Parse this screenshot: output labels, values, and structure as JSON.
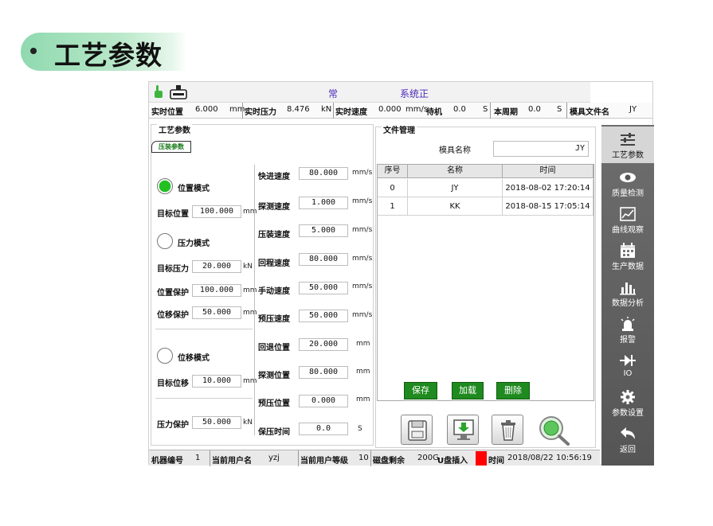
{
  "slide": {
    "title": "工艺参数"
  },
  "topbar": {
    "status_left": "常",
    "status_right": "系统正"
  },
  "infobar": {
    "pos_label": "实时位置",
    "pos_value": "6.000",
    "pos_unit": "mm",
    "force_label": "实时压力",
    "force_value": "8.476",
    "force_unit": "kN",
    "speed_label": "实时速度",
    "speed_value": "0.000",
    "speed_unit": "mm/s",
    "standby_label": "待机",
    "standby_value": "0.0",
    "standby_unit": "S",
    "cycle_label": "本周期",
    "cycle_value": "0.0",
    "cycle_unit": "S",
    "mold_label": "模具文件名",
    "mold_value": "JY"
  },
  "params": {
    "title": "工艺参数",
    "tab": "压装参数",
    "position_mode": "位置模式",
    "target_position_label": "目标位置",
    "target_position": "100.000",
    "mm": "mm",
    "pressure_mode": "压力模式",
    "target_pressure_label": "目标压力",
    "target_pressure": "20.000",
    "kN": "kN",
    "position_protect_label": "位置保护",
    "position_protect": "100.000",
    "displacement_protect_label": "位移保护",
    "displacement_protect": "50.000",
    "displacement_mode": "位移模式",
    "target_displacement_label": "目标位移",
    "target_displacement": "10.000",
    "pressure_protect_label": "压力保护",
    "pressure_protect": "50.000",
    "fast_speed_label": "快进速度",
    "fast_speed": "80.000",
    "mms": "mm/s",
    "probe_speed_label": "探测速度",
    "probe_speed": "1.000",
    "press_speed_label": "压装速度",
    "press_speed": "5.000",
    "return_speed_label": "回程速度",
    "return_speed": "80.000",
    "manual_speed_label": "手动速度",
    "manual_speed": "50.000",
    "prepress_speed_label": "预压速度",
    "prepress_speed": "50.000",
    "retreat_pos_label": "回退位置",
    "retreat_pos": "20.000",
    "probe_pos_label": "探测位置",
    "probe_pos": "80.000",
    "prepress_pos_label": "预压位置",
    "prepress_pos": "0.000",
    "hold_time_label": "保压时间",
    "hold_time": "0.0",
    "s": "S"
  },
  "files": {
    "title": "文件管理",
    "mold_name_label": "模具名称",
    "mold_name_value": "JY",
    "columns": [
      "序号",
      "名称",
      "时间"
    ],
    "rows": [
      {
        "idx": "0",
        "name": "JY",
        "time": "2018-08-02 17:20:14"
      },
      {
        "idx": "1",
        "name": "KK",
        "time": "2018-08-15 17:05:14"
      }
    ],
    "save": "保存",
    "load": "加载",
    "delete": "删除"
  },
  "sidebar": [
    {
      "label": "工艺参数",
      "icon": "sliders-icon"
    },
    {
      "label": "质量检测",
      "icon": "eye-icon"
    },
    {
      "label": "曲线观察",
      "icon": "curve-icon"
    },
    {
      "label": "生产数据",
      "icon": "calendar-icon"
    },
    {
      "label": "数据分析",
      "icon": "bar-chart-icon"
    },
    {
      "label": "报警",
      "icon": "alarm-icon"
    },
    {
      "label": "IO",
      "icon": "diode-icon"
    },
    {
      "label": "参数设置",
      "icon": "gear-icon"
    },
    {
      "label": "返回",
      "icon": "back-icon"
    }
  ],
  "bottombar": {
    "machine_label": "机器编号",
    "machine_value": "1",
    "user_label": "当前用户名",
    "user_value": "yzj",
    "level_label": "当前用户等级",
    "level_value": "10",
    "disk_label": "磁盘剩余",
    "disk_value": "200G",
    "usb_label": "U盘插入",
    "time_label": "时间",
    "date_value": "2018/08/22",
    "time_value": "10:56:19"
  },
  "colors": {
    "accent_green": "#1f8a1f",
    "usb_indicator": "#ff0000",
    "sidebar_bg": "#5f5f5f"
  }
}
